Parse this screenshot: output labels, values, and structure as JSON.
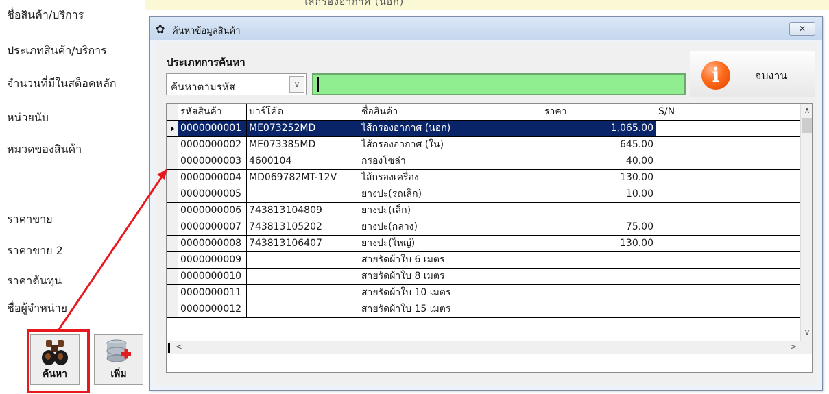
{
  "background_form": {
    "labels": [
      "ชื่อสินค้า/บริการ",
      "ประเภทสินค้า/บริการ",
      "จำนวนที่มีในสต็อคหลัก",
      "หน่วยนับ",
      "หมวดของสินค้า",
      "ราคาขาย",
      "ราคาขาย 2",
      "ราคาต้นทุน",
      "ชื่อผู้จำหน่าย"
    ],
    "search_button_label": "ค้นหา",
    "add_button_label": "เพิ่ม"
  },
  "dialog": {
    "title": "ค้นหาข้อมูลสินค้า",
    "close_label": "✕",
    "search_type_label": "ประเภทการค้นหา",
    "search_type_value": "ค้นหาตามรหัส",
    "search_text_value": "",
    "end_button_label": "จบงาน"
  },
  "table": {
    "columns": [
      "รหัสสินค้า",
      "บาร์โค้ด",
      "ชื่อสินค้า",
      "ราคา",
      "S/N"
    ],
    "rows": [
      {
        "code": "0000000001",
        "barcode": "ME073252MD",
        "name": "ไส้กรองอากาศ (นอก)",
        "price": "1,065.00",
        "sn": ""
      },
      {
        "code": "0000000002",
        "barcode": "ME073385MD",
        "name": "ไส้กรองอากาศ (ใน)",
        "price": "645.00",
        "sn": ""
      },
      {
        "code": "0000000003",
        "barcode": "4600104",
        "name": "กรองโซล่า",
        "price": "40.00",
        "sn": ""
      },
      {
        "code": "0000000004",
        "barcode": "MD069782MT-12V",
        "name": "ไส้กรองเครื่อง",
        "price": "130.00",
        "sn": ""
      },
      {
        "code": "0000000005",
        "barcode": "",
        "name": "ยางปะ(รถเล็ก)",
        "price": "10.00",
        "sn": ""
      },
      {
        "code": "0000000006",
        "barcode": "743813104809",
        "name": "ยางปะ(เล็ก)",
        "price": "",
        "sn": ""
      },
      {
        "code": "0000000007",
        "barcode": "743813105202",
        "name": "ยางปะ(กลาง)",
        "price": "75.00",
        "sn": ""
      },
      {
        "code": "0000000008",
        "barcode": "743813106407",
        "name": "ยางปะ(ใหญ่)",
        "price": "130.00",
        "sn": ""
      },
      {
        "code": "0000000009",
        "barcode": "",
        "name": "สายรัดผ้าใบ 6 เมตร",
        "price": "",
        "sn": ""
      },
      {
        "code": "0000000010",
        "barcode": "",
        "name": "สายรัดผ้าใบ 8 เมตร",
        "price": "",
        "sn": ""
      },
      {
        "code": "0000000011",
        "barcode": "",
        "name": "สายรัดผ้าใบ 10 เมตร",
        "price": "",
        "sn": ""
      },
      {
        "code": "0000000012",
        "barcode": "",
        "name": "สายรัดผ้าใบ 15 เมตร",
        "price": "",
        "sn": ""
      }
    ],
    "selected_row": 0
  },
  "colors": {
    "selection": "#0a246a",
    "search_field": "#90ee90",
    "highlight": "#e8181f"
  }
}
